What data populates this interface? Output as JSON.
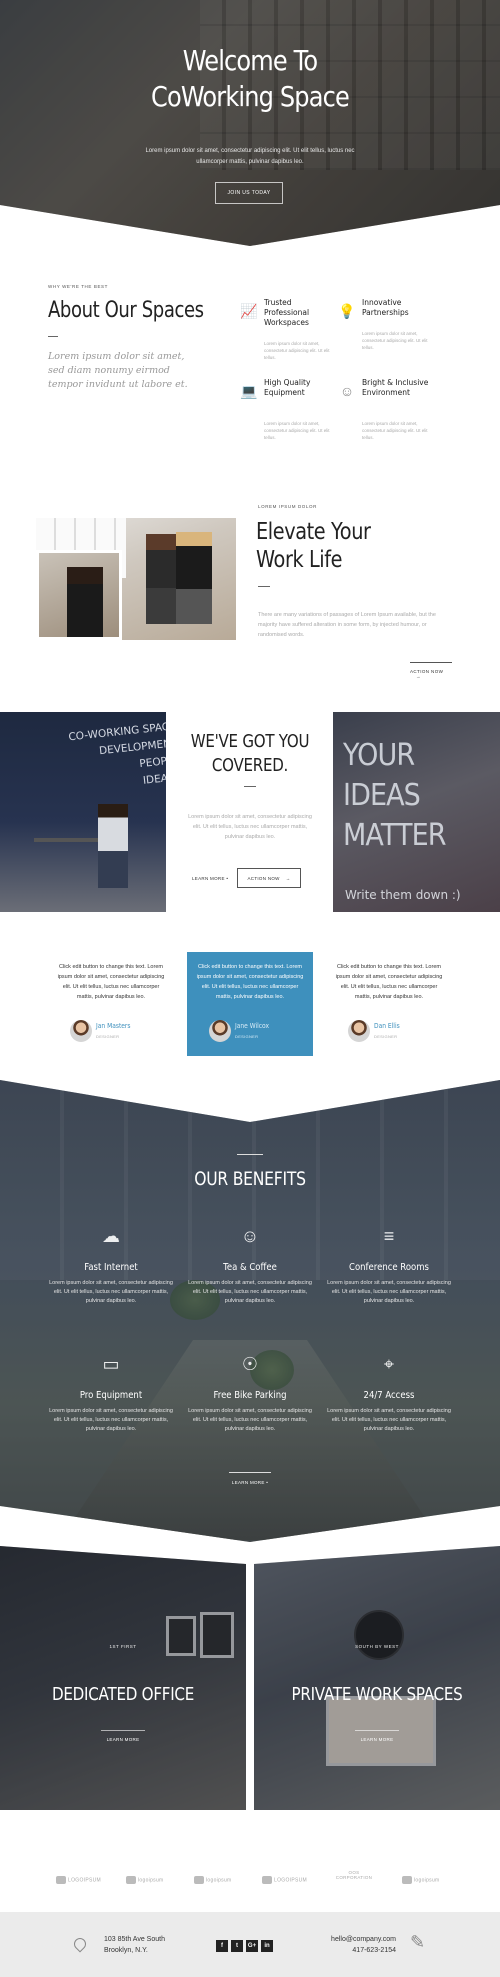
{
  "hero": {
    "title_line1": "Welcome To",
    "title_line2": "CoWorking Space",
    "subtitle_line1": "Lorem ipsum dolor sit amet, consectetur adipiscing elit. Ut elit tellus, luctus nec",
    "subtitle_line2": "ullamcorper mattis, pulvinar dapibus leo.",
    "cta": "JOIN US TODAY"
  },
  "about": {
    "eyebrow": "WHY WE'RE THE BEST",
    "title": "About Our Spaces",
    "lead": "Lorem ipsum dolor sit amet, sed diam nonumy eirmod tempor invidunt ut labore et.",
    "features": [
      {
        "icon": "chart-icon",
        "title": "Trusted Professional Workspaces",
        "text": "Lorem ipsum dolor sit amet, consectetur adipiscing elit. Ut elit tellus."
      },
      {
        "icon": "lightbulb-icon",
        "title": "Innovative Partnerships",
        "text": "Lorem ipsum dolor sit amet, consectetur adipiscing elit. Ut elit tellus."
      },
      {
        "icon": "laptop-icon",
        "title": "High Quality Equipment",
        "text": "Lorem ipsum dolor sit amet, consectetur adipiscing elit. Ut elit tellus."
      },
      {
        "icon": "smile-icon",
        "title": "Bright & Inclusive Environment",
        "text": "Lorem ipsum dolor sit amet, consectetur adipiscing elit. Ut elit tellus."
      }
    ]
  },
  "elevate": {
    "eyebrow": "LOREM IPSUM DOLOR",
    "title_line1": "Elevate Your",
    "title_line2": "Work Life",
    "body": "There are many variations of passages of Lorem Ipsum available, but the majority have suffered alteration in some form, by injected humour, or randomised words.",
    "action": "ACTION NOW"
  },
  "covered": {
    "left_image_text": [
      "CO-WORKING SPAC",
      "DEVELOPMEN",
      "PEOPL",
      "IDEAS"
    ],
    "right_image_text": [
      "YOUR",
      "IDEAS",
      "MATTER"
    ],
    "right_image_small": "Write them down :)",
    "title_line1": "WE'VE GOT YOU",
    "title_line2": "COVERED.",
    "body": "Lorem ipsum dolor sit amet, consectetur adipiscing elit. Ut elit tellus, luctus nec ullamcorper mattis, pulvinar dapibus leo.",
    "learn_more": "LEARN MORE",
    "action": "ACTION NOW"
  },
  "testimonials": [
    {
      "quote": "Click edit button to change this text. Lorem ipsum dolor sit amet, consectetur adipiscing elit. Ut elit tellus, luctus nec ullamcorper mattis, pulvinar dapibus leo.",
      "name": "Jan Masters",
      "role": "DESIGNER"
    },
    {
      "quote": "Click edit button to change this text. Lorem ipsum dolor sit amet, consectetur adipiscing elit. Ut elit tellus, luctus nec ullamcorper mattis, pulvinar dapibus leo.",
      "name": "Jane Wilcox",
      "role": "DESIGNER"
    },
    {
      "quote": "Click edit button to change this text. Lorem ipsum dolor sit amet, consectetur adipiscing elit. Ut elit tellus, luctus nec ullamcorper mattis, pulvinar dapibus leo.",
      "name": "Dan Ellis",
      "role": "DESIGNER"
    }
  ],
  "benefits": {
    "title": "OUR BENEFITS",
    "items": [
      {
        "icon": "cloud-icon",
        "title": "Fast Internet",
        "text": "Lorem ipsum dolor sit amet, consectetur adipiscing elit. Ut elit tellus, luctus nec ullamcorper mattis, pulvinar dapibus leo."
      },
      {
        "icon": "smile-icon",
        "title": "Tea & Coffee",
        "text": "Lorem ipsum dolor sit amet, consectetur adipiscing elit. Ut elit tellus, luctus nec ullamcorper mattis, pulvinar dapibus leo."
      },
      {
        "icon": "chart-icon",
        "title": "Conference Rooms",
        "text": "Lorem ipsum dolor sit amet, consectetur adipiscing elit. Ut elit tellus, luctus nec ullamcorper mattis, pulvinar dapibus leo."
      },
      {
        "icon": "monitor-icon",
        "title": "Pro Equipment",
        "text": "Lorem ipsum dolor sit amet, consectetur adipiscing elit. Ut elit tellus, luctus nec ullamcorper mattis, pulvinar dapibus leo."
      },
      {
        "icon": "bike-icon",
        "title": "Free Bike Parking",
        "text": "Lorem ipsum dolor sit amet, consectetur adipiscing elit. Ut elit tellus, luctus nec ullamcorper mattis, pulvinar dapibus leo."
      },
      {
        "icon": "location-icon",
        "title": "24/7 Access",
        "text": "Lorem ipsum dolor sit amet, consectetur adipiscing elit. Ut elit tellus, luctus nec ullamcorper mattis, pulvinar dapibus leo."
      }
    ],
    "learn_more": "LEARN MORE"
  },
  "spaces": [
    {
      "eyebrow": "1ST FIRST",
      "title": "DEDICATED OFFICE",
      "action": "LEARN MORE"
    },
    {
      "eyebrow": "SOUTH BY WEST",
      "title": "PRIVATE WORK SPACES",
      "action": "LEARN MORE"
    }
  ],
  "logos": [
    "LOGOIPSUM",
    "logoipsum",
    "logoipsum",
    "LOGOIPSUM",
    "OOS CORPORATION",
    "logoipsum"
  ],
  "footer": {
    "address_line1": "103 85th Ave South",
    "address_line2": "Brooklyn, N.Y.",
    "social": [
      "f",
      "t",
      "G+",
      "in"
    ],
    "email": "hello@company.com",
    "phone": "417-623-2154"
  }
}
